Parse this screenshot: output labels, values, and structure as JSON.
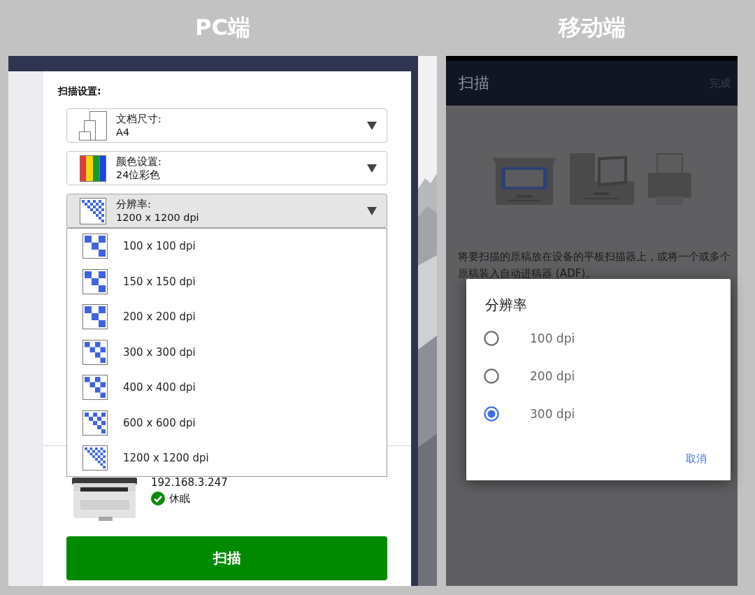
{
  "pc": {
    "heading": "PC端",
    "settings_title": "扫描设置:",
    "dropdowns": [
      {
        "kind": "size",
        "label": "文档尺寸:",
        "value": "A4",
        "expanded": false
      },
      {
        "kind": "color",
        "label": "颜色设置:",
        "value": "24位彩色",
        "expanded": false
      },
      {
        "kind": "resolution",
        "label": "分辨率:",
        "value": "1200 x 1200 dpi",
        "expanded": true
      }
    ],
    "resolution_options": [
      {
        "label": "100 x 100 dpi",
        "selected": false
      },
      {
        "label": "150 x 150 dpi",
        "selected": false
      },
      {
        "label": "200 x 200 dpi",
        "selected": false
      },
      {
        "label": "300 x 300 dpi",
        "selected": false
      },
      {
        "label": "400 x 400 dpi",
        "selected": false
      },
      {
        "label": "600 x 600 dpi",
        "selected": false
      },
      {
        "label": "1200 x 1200 dpi",
        "selected": false
      }
    ],
    "device": {
      "ip": "192.168.3.247",
      "status": "休眠"
    },
    "scan_button": "扫描"
  },
  "mobile": {
    "heading": "移动端",
    "title": "扫描",
    "done": "完成",
    "instructions": "将要扫描的原稿放在设备的平板扫描器上，或将一个或多个原稿装入自动进稿器 (ADF)。",
    "dialog": {
      "title": "分辨率",
      "options": [
        {
          "label": "100 dpi",
          "selected": false
        },
        {
          "label": "200 dpi",
          "selected": false
        },
        {
          "label": "300 dpi",
          "selected": true
        }
      ],
      "cancel": "取消"
    }
  }
}
